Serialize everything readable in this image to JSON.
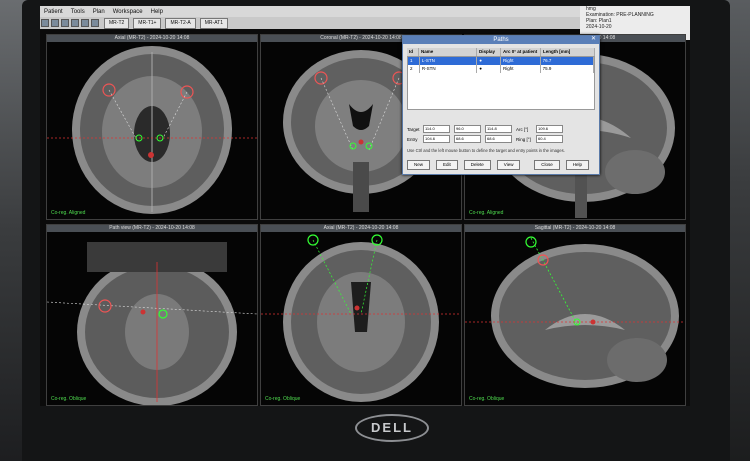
{
  "menu": {
    "items": [
      "Patient",
      "Tools",
      "Plan",
      "Workspace",
      "Help"
    ],
    "right": [
      "hmg",
      "Examination: PRE-PLANNING"
    ]
  },
  "toolbar": {
    "tabs": [
      "MR-T2",
      "MR-T1+",
      "MR-T2-A",
      "MR-AT1"
    ],
    "date": "2024-10-20"
  },
  "session": {
    "lines": [
      "hmg",
      "Examination: PRE-PLANNING",
      "Plan: Plan1",
      "2024-10-20"
    ]
  },
  "viewports": [
    {
      "title": "Axial (MR-T2) - 2024-10-20 14:08",
      "label": "Co-reg. Aligned"
    },
    {
      "title": "Coronal (MR-T2) - 2024-10-20 14:08",
      "label": ""
    },
    {
      "title": "Sagittal (MR-T2) - 2024-10-20 14:08",
      "label": "Co-reg. Aligned"
    },
    {
      "title": "Path view (MR-T2) - 2024-10-20 14:08",
      "label": "Co-reg. Oblique"
    },
    {
      "title": "Axial (MR-T2) - 2024-10-20 14:08",
      "label": "Co-reg. Oblique"
    },
    {
      "title": "Sagittal (MR-T2) - 2024-10-20 14:08",
      "label": "Co-reg. Oblique"
    }
  ],
  "paths_dialog": {
    "title": "Paths",
    "columns": [
      "Id",
      "Name",
      "Display",
      "Arc 0° at patient",
      "Length [mm]"
    ],
    "rows": [
      {
        "id": "1",
        "name": "L-STN",
        "display": "●",
        "side": "Right",
        "length": "76.7",
        "selected": true
      },
      {
        "id": "2",
        "name": "R-STN",
        "display": "●",
        "side": "Right",
        "length": "75.9",
        "selected": false
      }
    ],
    "target_label": "Target",
    "entry_label": "Entry",
    "target": [
      "114.0",
      "96.0",
      "114.8"
    ],
    "entry": [
      "104.6",
      "68.6",
      "68.6"
    ],
    "arc_label": "Arc [°]",
    "ring_label": "Ring [°]",
    "arc": "109.6",
    "ring": "60.4",
    "hint": "Use Ctrl and the left mouse button to define the target and entry points in the images.",
    "buttons": [
      "New",
      "Edit",
      "Delete",
      "View",
      "Close",
      "Help"
    ]
  },
  "brand": "DELL"
}
